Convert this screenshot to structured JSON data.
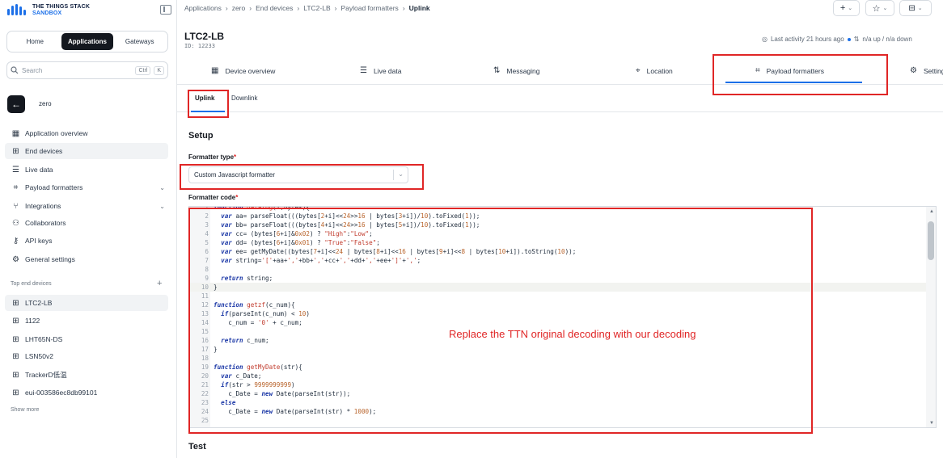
{
  "brand": {
    "line1": "THE THINGS STACK",
    "line2": "SANDBOX"
  },
  "segments": [
    "Home",
    "Applications",
    "Gateways"
  ],
  "search": {
    "placeholder": "Search",
    "kbd1": "Ctrl",
    "kbd2": "K"
  },
  "app": {
    "name": "zero"
  },
  "nav": [
    {
      "label": "Application overview",
      "icon": "grid"
    },
    {
      "label": "End devices",
      "icon": "chip"
    },
    {
      "label": "Live data",
      "icon": "list"
    },
    {
      "label": "Payload formatters",
      "icon": "code"
    },
    {
      "label": "Integrations",
      "icon": "fork"
    },
    {
      "label": "Collaborators",
      "icon": "users"
    },
    {
      "label": "API keys",
      "icon": "key"
    },
    {
      "label": "General settings",
      "icon": "gear"
    }
  ],
  "top_devices_label": "Top end devices",
  "devices": [
    "LTC2-LB",
    "1122",
    "LHT65N-DS",
    "LSN50v2",
    "TrackerD低温",
    "eui-003586ec8db99101"
  ],
  "show_more": "Show more",
  "breadcrumbs": [
    "Applications",
    "zero",
    "End devices",
    "LTC2-LB",
    "Payload formatters",
    "Uplink"
  ],
  "device": {
    "title": "LTC2-LB",
    "id": "ID: 12233"
  },
  "activity": {
    "last": "Last activity 21 hours ago",
    "traffic": "n/a up / n/a down"
  },
  "tabs": [
    "Device overview",
    "Live data",
    "Messaging",
    "Location",
    "Payload formatters",
    "Settings"
  ],
  "subtabs": [
    "Uplink",
    "Downlink"
  ],
  "setup": {
    "heading": "Setup",
    "formatter_type_label": "Formatter type",
    "formatter_value": "Custom Javascript formatter",
    "formatter_code_label": "Formatter code"
  },
  "code_lines": [
    "function datalog(i,bytes){",
    "  var aa= parseFloat(((bytes[2+i]<<24>>16 | bytes[3+i])/10).toFixed(1));",
    "  var bb= parseFloat(((bytes[4+i]<<24>>16 | bytes[5+i])/10).toFixed(1));",
    "  var cc= (bytes[6+i]&0x02) ? \"High\":\"Low\";",
    "  var dd= (bytes[6+i]&0x01) ? \"True\":\"False\";",
    "  var ee= getMyDate((bytes[7+i]<<24 | bytes[8+i]<<16 | bytes[9+i]<<8 | bytes[10+i]).toString(10));",
    "  var string='['+aa+','+bb+','+cc+','+dd+','+ee+']'+',';",
    "",
    "  return string;",
    "}",
    "",
    "function getzf(c_num){",
    "  if(parseInt(c_num) < 10)",
    "    c_num = '0' + c_num;",
    "",
    "  return c_num;",
    "}",
    "",
    "function getMyDate(str){",
    "  var c_Date;",
    "  if(str > 9999999999)",
    "    c_Date = new Date(parseInt(str));",
    "  else",
    "    c_Date = new Date(parseInt(str) * 1000);",
    ""
  ],
  "annotation": "Replace the TTN original decoding with our decoding",
  "test_heading": "Test",
  "colors": {
    "accent": "#1b6fe8",
    "highlight_box": "#e02626",
    "primary_dark": "#14181f"
  }
}
